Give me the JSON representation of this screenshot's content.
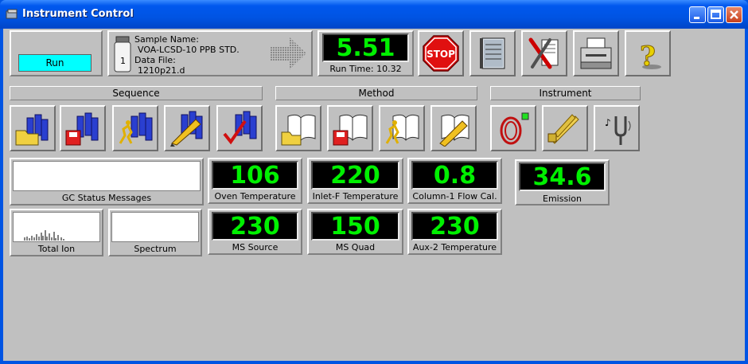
{
  "window": {
    "title": "Instrument Control"
  },
  "status": {
    "state": "Run"
  },
  "sample": {
    "vial_number": "1",
    "sample_name_label": "Sample Name:",
    "sample_name": "VOA-LCSD-10 PPB STD.",
    "data_file_label": "Data File:",
    "data_file": "1210p21.d"
  },
  "run_time": {
    "value": "5.51",
    "label": "Run Time: 10.32"
  },
  "toolbar": {
    "stop_label": "STOP",
    "buttons": [
      "stop-icon",
      "notebook-icon",
      "tools-icon",
      "printer-icon",
      "help-icon"
    ]
  },
  "groups": {
    "sequence": "Sequence",
    "method": "Method",
    "instrument": "Instrument"
  },
  "gauges": {
    "oven": {
      "value": "106",
      "label": "Oven Temperature"
    },
    "inlet": {
      "value": "220",
      "label": "Inlet-F Temperature"
    },
    "column": {
      "value": "0.8",
      "label": "Column-1 Flow Cal."
    },
    "emission": {
      "value": "34.6",
      "label": "Emission"
    },
    "ms_source": {
      "value": "230",
      "label": "MS Source"
    },
    "ms_quad": {
      "value": "150",
      "label": "MS Quad"
    },
    "aux2": {
      "value": "230",
      "label": "Aux-2 Temperature"
    }
  },
  "panels": {
    "gc_status": "GC Status Messages",
    "total_ion": "Total Ion",
    "spectrum": "Spectrum"
  },
  "colors": {
    "lcd_text": "#00f000",
    "run_bg": "#00ffff",
    "titlebar": "#0054e3"
  }
}
